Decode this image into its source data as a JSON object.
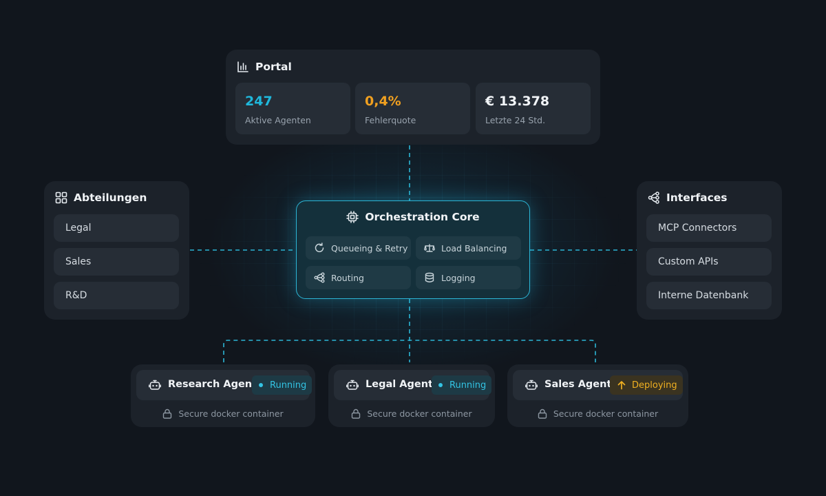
{
  "portal": {
    "title": "Portal",
    "icon": "bar-chart-icon",
    "stats": [
      {
        "value": "247",
        "label": "Aktive Agenten",
        "color": "#1fb8dc"
      },
      {
        "value": "0,4%",
        "label": "Fehlerquote",
        "color": "#f0a020"
      },
      {
        "value": "€ 13.378",
        "label": "Letzte 24 Std.",
        "color": "#f1f4f7"
      }
    ]
  },
  "departments": {
    "title": "Abteilungen",
    "icon": "grid-icon",
    "items": [
      "Legal",
      "Sales",
      "R&D"
    ]
  },
  "interfaces": {
    "title": "Interfaces",
    "icon": "share-nodes-icon",
    "items": [
      "MCP Connectors",
      "Custom APIs",
      "Interne Datenbank"
    ]
  },
  "core": {
    "title": "Orchestration Core",
    "icon": "cpu-icon",
    "features": [
      {
        "label": "Queueing & Retry",
        "icon": "refresh-icon"
      },
      {
        "label": "Load Balancing",
        "icon": "scale-icon"
      },
      {
        "label": "Routing",
        "icon": "routing-icon"
      },
      {
        "label": "Logging",
        "icon": "database-icon"
      }
    ]
  },
  "agents": [
    {
      "name": "Research Agent",
      "status": "Running",
      "status_type": "running",
      "footer": "Secure docker container",
      "icon": "robot-icon"
    },
    {
      "name": "Legal Agent",
      "status": "Running",
      "status_type": "running",
      "footer": "Secure docker container",
      "icon": "robot-icon"
    },
    {
      "name": "Sales Agent",
      "status": "Deploying",
      "status_type": "deploying",
      "footer": "Secure docker container",
      "icon": "robot-icon"
    }
  ],
  "colors": {
    "accent": "#2cb6d6",
    "background": "#11161d",
    "panel": "#1c222a",
    "running": "#33c4e4",
    "deploying": "#f0b021"
  }
}
